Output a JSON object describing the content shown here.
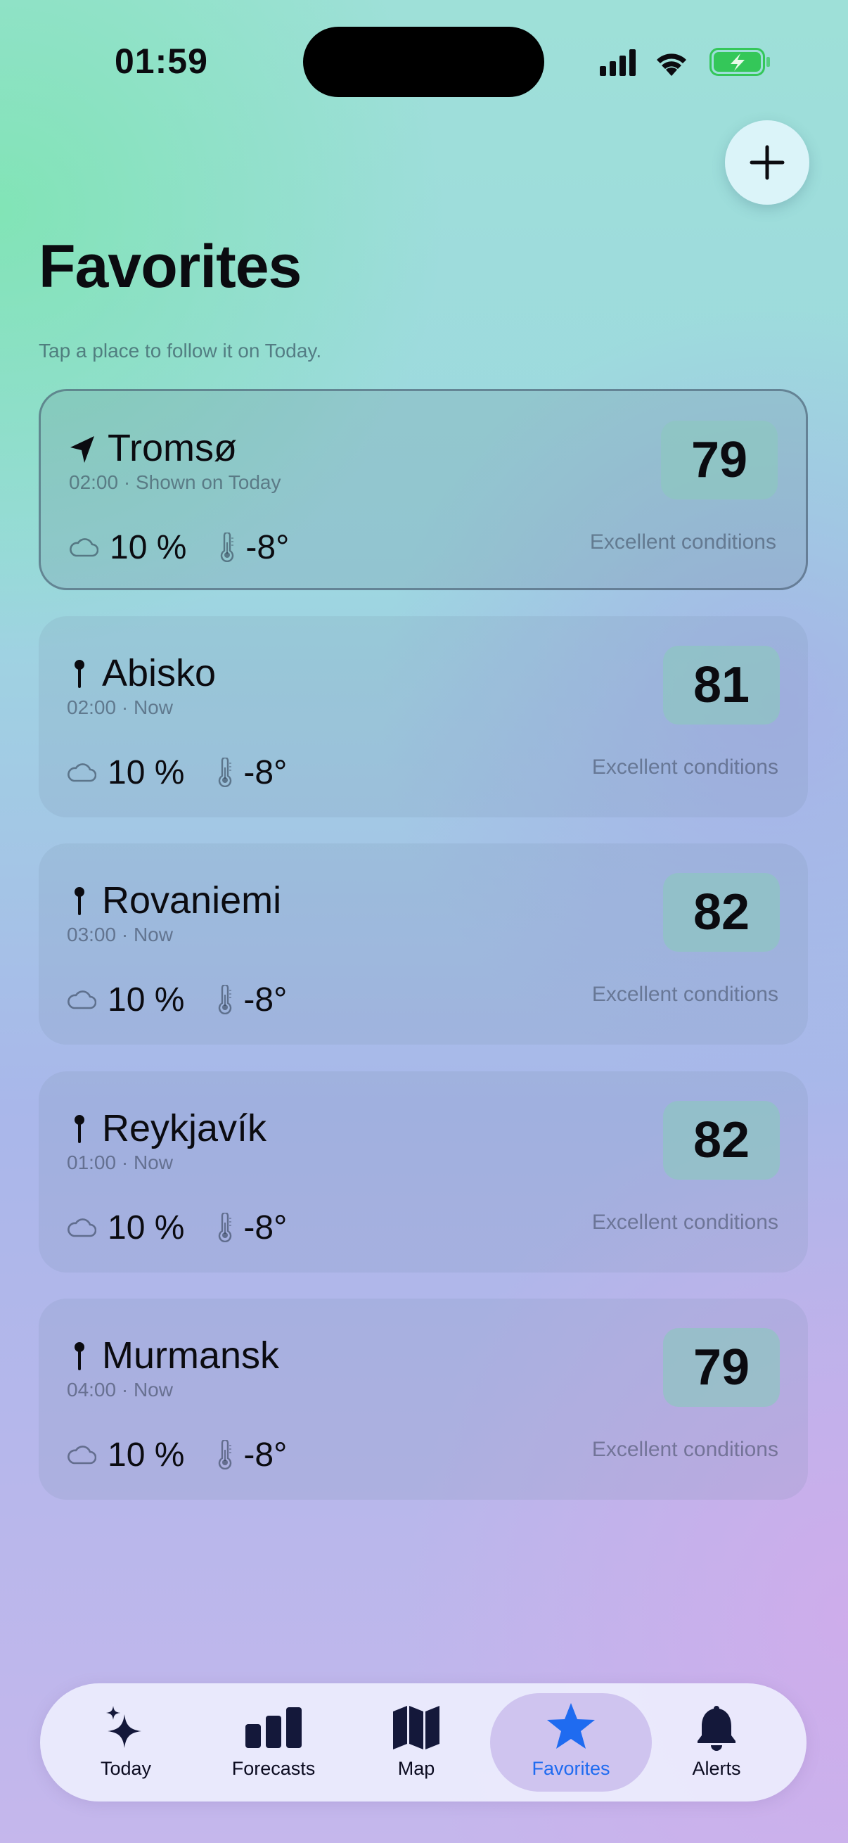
{
  "status_bar": {
    "time": "01:59"
  },
  "header": {
    "title": "Favorites",
    "subtitle": "Tap a place to follow it on Today.",
    "add_icon": "plus-icon"
  },
  "favorites": [
    {
      "name": "Tromsø",
      "icon": "location-arrow-icon",
      "meta": "02:00 · Shown on Today",
      "cloud": "10 %",
      "temp": "-8°",
      "score": "79",
      "condition": "Excellent conditions",
      "selected": true
    },
    {
      "name": "Abisko",
      "icon": "pin-icon",
      "meta": "02:00 · Now",
      "cloud": "10 %",
      "temp": "-8°",
      "score": "81",
      "condition": "Excellent conditions",
      "selected": false
    },
    {
      "name": "Rovaniemi",
      "icon": "pin-icon",
      "meta": "03:00 · Now",
      "cloud": "10 %",
      "temp": "-8°",
      "score": "82",
      "condition": "Excellent conditions",
      "selected": false
    },
    {
      "name": "Reykjavík",
      "icon": "pin-icon",
      "meta": "01:00 · Now",
      "cloud": "10 %",
      "temp": "-8°",
      "score": "82",
      "condition": "Excellent conditions",
      "selected": false
    },
    {
      "name": "Murmansk",
      "icon": "pin-icon",
      "meta": "04:00 · Now",
      "cloud": "10 %",
      "temp": "-8°",
      "score": "79",
      "condition": "Excellent conditions",
      "selected": false
    }
  ],
  "tabs": [
    {
      "label": "Today",
      "icon": "sparkles-icon",
      "active": false
    },
    {
      "label": "Forecasts",
      "icon": "bar-chart-icon",
      "active": false
    },
    {
      "label": "Map",
      "icon": "map-icon",
      "active": false
    },
    {
      "label": "Favorites",
      "icon": "star-icon",
      "active": true
    },
    {
      "label": "Alerts",
      "icon": "bell-icon",
      "active": false
    }
  ],
  "colors": {
    "accent": "#1f6bf0",
    "score_bg": "#8cc8be",
    "battery": "#34c759"
  }
}
